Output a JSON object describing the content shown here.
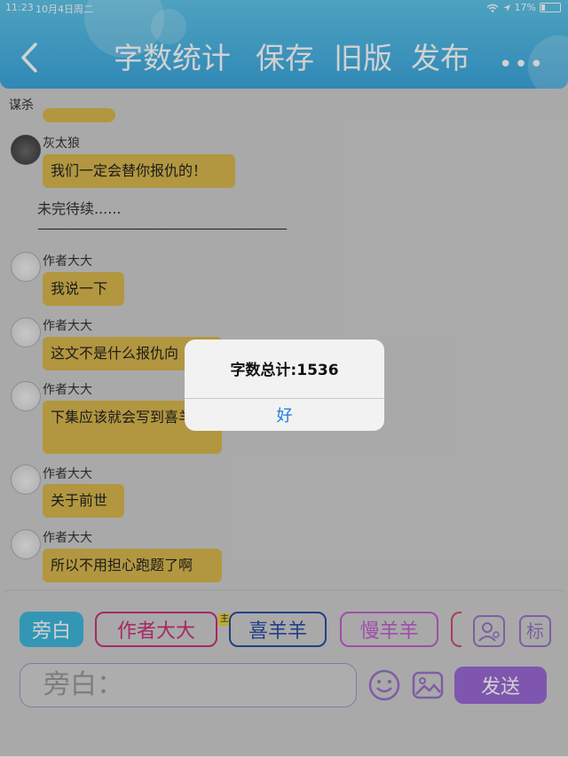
{
  "status": {
    "time": "11:23",
    "date": "10月4日周二",
    "battery": "17%"
  },
  "header": {
    "buttons": [
      "字数统计",
      "保存",
      "旧版",
      "发布"
    ]
  },
  "chat": {
    "section_label": "谋杀",
    "messages": [
      {
        "speaker": "灰太狼",
        "text": "我们一定会替你报仇的！"
      },
      {
        "narration": "未完待续......",
        "dashes": "————————————————————"
      },
      {
        "speaker": "作者大大",
        "text": "我说一下"
      },
      {
        "speaker": "作者大大",
        "text": "这文不是什么报仇向"
      },
      {
        "speaker": "作者大大",
        "text": "下集应该就会写到喜羊羊"
      },
      {
        "speaker": "作者大大",
        "text": "关于前世"
      },
      {
        "speaker": "作者大大",
        "text": "所以不用担心跑题了啊"
      }
    ]
  },
  "alert": {
    "title": "字数总计:1536",
    "ok_label": "好"
  },
  "roles": {
    "narration": "旁白",
    "author": "作者大大",
    "main_badge": "主",
    "xiyangyang": "喜羊羊",
    "manyangyang": "慢羊羊",
    "tag_icon_label": "标"
  },
  "input": {
    "placeholder": "旁白："
  },
  "send_label": "发送"
}
